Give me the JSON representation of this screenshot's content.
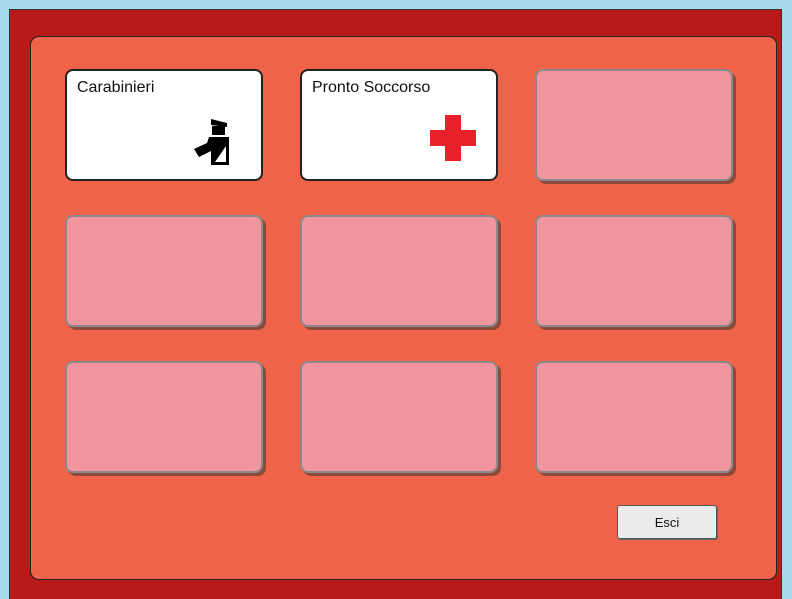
{
  "tiles": [
    {
      "label": "Carabinieri",
      "icon": "carabinieri-officer-icon"
    },
    {
      "label": "Pronto Soccorso",
      "icon": "red-cross-icon"
    },
    {
      "label": "",
      "icon": ""
    },
    {
      "label": "",
      "icon": ""
    },
    {
      "label": "",
      "icon": ""
    },
    {
      "label": "",
      "icon": ""
    },
    {
      "label": "",
      "icon": ""
    },
    {
      "label": "",
      "icon": ""
    },
    {
      "label": "",
      "icon": ""
    }
  ],
  "exit_button": {
    "label": "Esci"
  },
  "colors": {
    "background": "#a8d8ec",
    "frame": "#b81a1a",
    "panel": "#ef6448",
    "empty_tile": "#f1959f",
    "cross": "#e8202a"
  }
}
